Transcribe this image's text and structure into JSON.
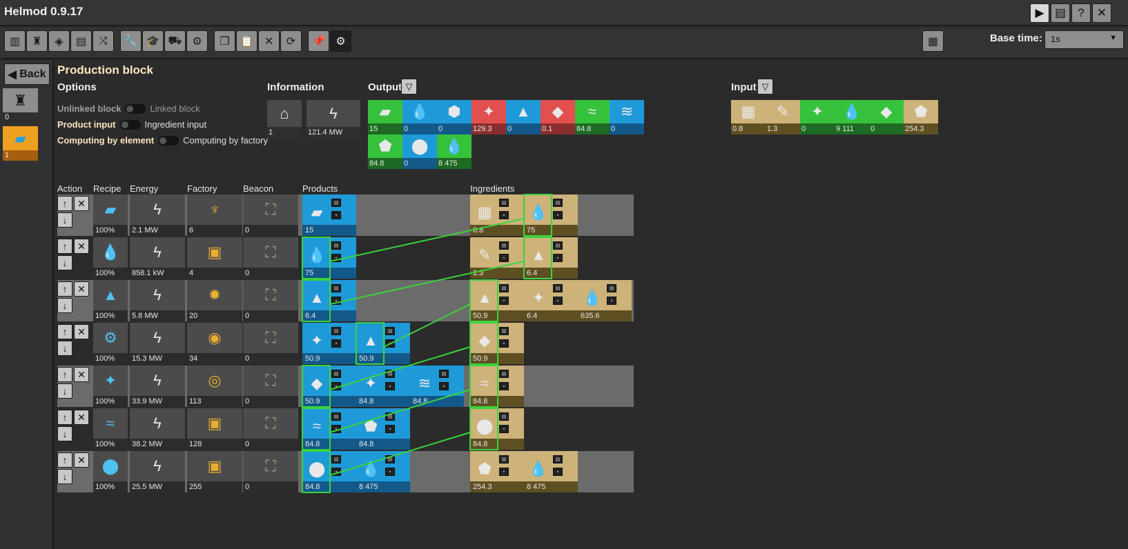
{
  "app": {
    "title": "Helmod 0.9.17"
  },
  "titlebar_buttons": [
    {
      "name": "play-button",
      "glyph": "▶"
    },
    {
      "name": "admin-button",
      "glyph": "▤"
    },
    {
      "name": "help-button",
      "glyph": "?"
    },
    {
      "name": "close-button",
      "glyph": "✕"
    }
  ],
  "toolbar": {
    "tools": [
      {
        "name": "factory-icon",
        "glyph": "▥"
      },
      {
        "name": "production-icon",
        "glyph": "♜"
      },
      {
        "name": "energy-icon",
        "glyph": "◈"
      },
      {
        "name": "summary-icon",
        "glyph": "▤"
      },
      {
        "name": "graph-icon",
        "glyph": "⤨"
      },
      {
        "name": "wrench-icon",
        "glyph": "🔧"
      },
      {
        "name": "education-icon",
        "glyph": "🎓"
      },
      {
        "name": "logistics-icon",
        "glyph": "⛟"
      },
      {
        "name": "settings-gears-icon",
        "glyph": "⚙"
      },
      {
        "name": "copy-icon",
        "glyph": "❐"
      },
      {
        "name": "paste-icon",
        "glyph": "📋"
      },
      {
        "name": "delete-icon",
        "glyph": "✕"
      },
      {
        "name": "refresh-icon",
        "glyph": "⟳"
      },
      {
        "name": "pin-icon",
        "glyph": "📌"
      },
      {
        "name": "gear-icon",
        "glyph": "⚙"
      }
    ],
    "calculator_glyph": "▦",
    "base_time_label": "Base time:",
    "base_time_value": "1s",
    "dropdown_glyph": "▼"
  },
  "left_panel": {
    "back_label": "Back",
    "blocks": [
      {
        "icon": "♜",
        "value": "0",
        "bg": "#8e8e8e",
        "val_bg": "#2f2f2f",
        "icon_color": "#1a1a1a"
      },
      {
        "icon": "▰",
        "value": "1",
        "bg": "#f0a020",
        "val_bg": "#a35e0e",
        "icon_color": "#2a9ee0"
      }
    ]
  },
  "main": {
    "title": "Production block",
    "options": {
      "heading": "Options",
      "rows": [
        {
          "a": "Unlinked block",
          "b": "Linked block",
          "a_on": false,
          "b_on": false
        },
        {
          "a": "Product input",
          "b": "Ingredient input",
          "a_on": true,
          "b_on": true
        },
        {
          "a": "Computing by element",
          "b": "Computing by factory",
          "a_on": true,
          "b_on": true
        }
      ]
    },
    "information": {
      "heading": "Information",
      "cells": [
        {
          "icon": "⌂",
          "value": "1"
        },
        {
          "icon": "ϟ",
          "value": "121.4 MW"
        }
      ]
    },
    "output": {
      "heading": "Output",
      "filter_glyph": "▽",
      "items": [
        {
          "color": "green",
          "icon": "▰",
          "value": "15"
        },
        {
          "color": "blue",
          "icon": "💧",
          "value": "0"
        },
        {
          "color": "blue",
          "icon": "⬢",
          "value": "0"
        },
        {
          "color": "red",
          "icon": "✦",
          "value": "129.3"
        },
        {
          "color": "blue",
          "icon": "▲",
          "value": "0"
        },
        {
          "color": "red",
          "icon": "◆",
          "value": "0.1"
        },
        {
          "color": "green",
          "icon": "≈",
          "value": "84.8"
        },
        {
          "color": "blue",
          "icon": "≋",
          "value": "0"
        },
        {
          "color": "green",
          "icon": "⬟",
          "value": "84.8"
        },
        {
          "color": "blue",
          "icon": "⬤",
          "value": "0"
        },
        {
          "color": "green",
          "icon": "💧",
          "value": "8 475"
        }
      ]
    },
    "input": {
      "heading": "Input",
      "filter_glyph": "▽",
      "items": [
        {
          "color": "tan",
          "icon": "▦",
          "value": "0.8"
        },
        {
          "color": "tan",
          "icon": "✎",
          "value": "1.3"
        },
        {
          "color": "green",
          "icon": "✦",
          "value": "0"
        },
        {
          "color": "green",
          "icon": "💧",
          "value": "9 111"
        },
        {
          "color": "green",
          "icon": "◆",
          "value": "0"
        },
        {
          "color": "tan",
          "icon": "⬟",
          "value": "254.3"
        }
      ]
    },
    "table": {
      "headers": [
        "Action",
        "Recipe",
        "Energy",
        "Factory",
        "Beacon",
        "Products",
        "Ingredients"
      ],
      "up_glyph": "↑",
      "down_glyph": "↓",
      "delete_glyph": "✕",
      "rows": [
        {
          "recipe_icon": "▰",
          "recipe_pct": "100%",
          "energy": "2.1 MW",
          "factory_icon": "♆",
          "factories": "6",
          "beacon_icon": "⛶",
          "beacons": "0",
          "products": [
            {
              "icon": "▰",
              "value": "15"
            }
          ],
          "ingredients": [
            {
              "icon": "▦",
              "value": "0.8"
            },
            {
              "icon": "💧",
              "value": "75"
            }
          ]
        },
        {
          "recipe_icon": "💧",
          "recipe_pct": "100%",
          "energy": "858.1 kW",
          "factory_icon": "▣",
          "factories": "4",
          "beacon_icon": "⛶",
          "beacons": "0",
          "products": [
            {
              "icon": "💧",
              "value": "75"
            }
          ],
          "ingredients": [
            {
              "icon": "✎",
              "value": "1.3"
            },
            {
              "icon": "▲",
              "value": "6.4"
            }
          ]
        },
        {
          "recipe_icon": "▲",
          "recipe_pct": "100%",
          "energy": "5.8 MW",
          "factory_icon": "✹",
          "factories": "20",
          "beacon_icon": "⛶",
          "beacons": "0",
          "products": [
            {
              "icon": "▲",
              "value": "6.4"
            }
          ],
          "ingredients": [
            {
              "icon": "▲",
              "value": "50.9"
            },
            {
              "icon": "✦",
              "value": "6.4"
            },
            {
              "icon": "💧",
              "value": "635.6"
            }
          ]
        },
        {
          "recipe_icon": "⚙",
          "recipe_pct": "100%",
          "energy": "15.3 MW",
          "factory_icon": "◉",
          "factories": "34",
          "beacon_icon": "⛶",
          "beacons": "0",
          "products": [
            {
              "icon": "✦",
              "value": "50.9"
            },
            {
              "icon": "▲",
              "value": "50.9"
            }
          ],
          "ingredients": [
            {
              "icon": "◆",
              "value": "50.9"
            }
          ]
        },
        {
          "recipe_icon": "✦",
          "recipe_pct": "100%",
          "energy": "33.9 MW",
          "factory_icon": "◎",
          "factories": "113",
          "beacon_icon": "⛶",
          "beacons": "0",
          "products": [
            {
              "icon": "◆",
              "value": "50.9"
            },
            {
              "icon": "✦",
              "value": "84.8"
            },
            {
              "icon": "≋",
              "value": "84.8"
            }
          ],
          "ingredients": [
            {
              "icon": "≈",
              "value": "84.8"
            }
          ]
        },
        {
          "recipe_icon": "≈",
          "recipe_pct": "100%",
          "energy": "38.2 MW",
          "factory_icon": "▣",
          "factories": "128",
          "beacon_icon": "⛶",
          "beacons": "0",
          "products": [
            {
              "icon": "≈",
              "value": "84.8"
            },
            {
              "icon": "⬟",
              "value": "84.8"
            }
          ],
          "ingredients": [
            {
              "icon": "⬤",
              "value": "84.8"
            }
          ]
        },
        {
          "recipe_icon": "⬤",
          "recipe_pct": "100%",
          "energy": "25.5 MW",
          "factory_icon": "▣",
          "factories": "255",
          "beacon_icon": "⛶",
          "beacons": "0",
          "products": [
            {
              "icon": "⬤",
              "value": "84.8"
            },
            {
              "icon": "💧",
              "value": "8 475"
            }
          ],
          "ingredients": [
            {
              "icon": "⬟",
              "value": "254.3"
            },
            {
              "icon": "💧",
              "value": "8 475"
            }
          ]
        }
      ]
    }
  },
  "colors": {
    "output_green": "#36c23d",
    "output_blue": "#1f9ad8",
    "output_red": "#e24f4f",
    "input_tan": "#cdb27a",
    "link_green": "#3bd43b",
    "title_cream": "#ffe6c0"
  }
}
